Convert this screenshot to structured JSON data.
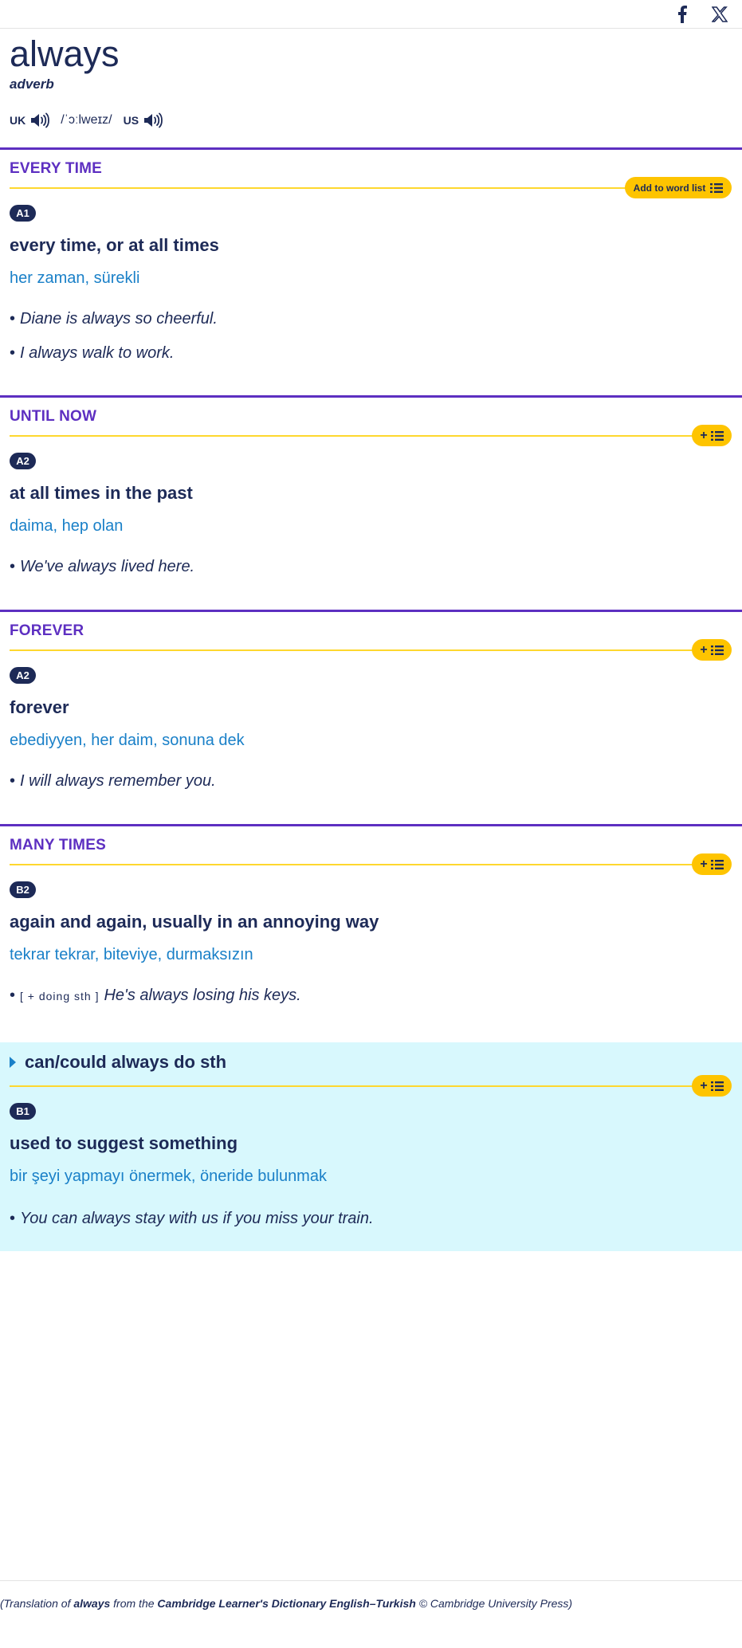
{
  "social": {
    "facebook_icon": "facebook-icon",
    "x_icon": "x-icon"
  },
  "entry": {
    "headword": "always",
    "pos": "adverb",
    "uk_label": "UK",
    "us_label": "US",
    "ipa": "/ˈɔːlweɪz/"
  },
  "add_to_word_list": "Add to word list",
  "plus": "+",
  "senses": [
    {
      "guide": "EVERY TIME",
      "level": "A1",
      "definition": "every time, or at all times",
      "translation": "her zaman, sürekli",
      "examples": [
        "Diane is always so cheerful.",
        "I always walk to work."
      ]
    },
    {
      "guide": "UNTIL NOW",
      "level": "A2",
      "definition": "at all times in the past",
      "translation": "daima, hep olan",
      "examples": [
        "We've always lived here."
      ]
    },
    {
      "guide": "FOREVER",
      "level": "A2",
      "definition": "forever",
      "translation": "ebediyyen, her daim, sonuna dek",
      "examples": [
        "I will always remember you."
      ]
    },
    {
      "guide": "MANY TIMES",
      "level": "B2",
      "definition": "again and again, usually in an annoying way",
      "translation": "tekrar tekrar, biteviye, durmaksızın",
      "grammar": "[ + doing sth ]",
      "examples": [
        "He's always losing his keys."
      ]
    }
  ],
  "phrase": {
    "title": "can/could always do sth",
    "level": "B1",
    "definition": "used to suggest something",
    "translation": "bir şeyi yapmayı önermek, öneride bulunmak",
    "examples": [
      "You can always stay with us if you miss your train."
    ]
  },
  "footer": {
    "pre": "(Translation of ",
    "word": "always",
    "mid": " from the ",
    "dictionary": "Cambridge Learner's Dictionary English–Turkish",
    "post": " © Cambridge University Press)"
  }
}
